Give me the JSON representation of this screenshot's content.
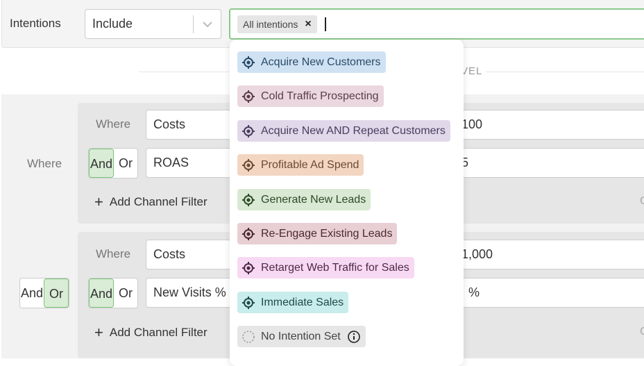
{
  "top_bar": {
    "label": "Intentions",
    "mode_select": "Include",
    "chips": [
      "All intentions"
    ],
    "chip_remove_glyph": "×"
  },
  "divider": {
    "text": "VEL"
  },
  "filter_groups": [
    {
      "where_label": "Where",
      "and_label": "And",
      "or_label": "Or",
      "rows": [
        {
          "label": "Where",
          "field": "Costs",
          "value": "100"
        },
        {
          "field": "ROAS",
          "value": "5"
        }
      ],
      "add_label": "Add Channel Filter",
      "right_glyph": "C"
    },
    {
      "rows": [
        {
          "label": "Where",
          "field": "Costs",
          "value": "1,000"
        },
        {
          "field": "New Visits %",
          "value": "%"
        }
      ],
      "add_label": "Add Channel Filter",
      "right_glyph": "C"
    }
  ],
  "outer_where": "Where",
  "group_connector": {
    "and_label": "And",
    "or_label": "Or",
    "selected": "Or"
  },
  "row_connector": {
    "and_label": "And",
    "or_label": "Or",
    "selected": "And"
  },
  "options": [
    {
      "label": "Acquire New Customers",
      "bg": "#cfe2f3",
      "fg": "#2a4a66",
      "icon": "target-icon"
    },
    {
      "label": "Cold Traffic Prospecting",
      "bg": "#ead7df",
      "fg": "#5a3d48",
      "icon": "target-icon"
    },
    {
      "label": "Acquire New AND Repeat Customers",
      "bg": "#e1d8ea",
      "fg": "#4a3d5e",
      "icon": "target-icon"
    },
    {
      "label": "Profitable Ad Spend",
      "bg": "#f2d6c2",
      "fg": "#6b4a33",
      "icon": "target-icon"
    },
    {
      "label": "Generate New Leads",
      "bg": "#d9e9d3",
      "fg": "#2f4a2a",
      "icon": "target-icon"
    },
    {
      "label": "Re-Engage Existing Leads",
      "bg": "#e8cfd3",
      "fg": "#4a2a30",
      "icon": "target-icon"
    },
    {
      "label": "Retarget Web Traffic for Sales",
      "bg": "#f8d9f3",
      "fg": "#4a2a48",
      "icon": "target-icon"
    },
    {
      "label": "Immediate Sales",
      "bg": "#c9ecec",
      "fg": "#1f4a4a",
      "icon": "target-icon"
    },
    {
      "label": "No Intention Set",
      "bg": "#e6e6e6",
      "fg": "#444444",
      "icon": "dashed-circle-icon",
      "info_icon": "info-icon"
    }
  ]
}
